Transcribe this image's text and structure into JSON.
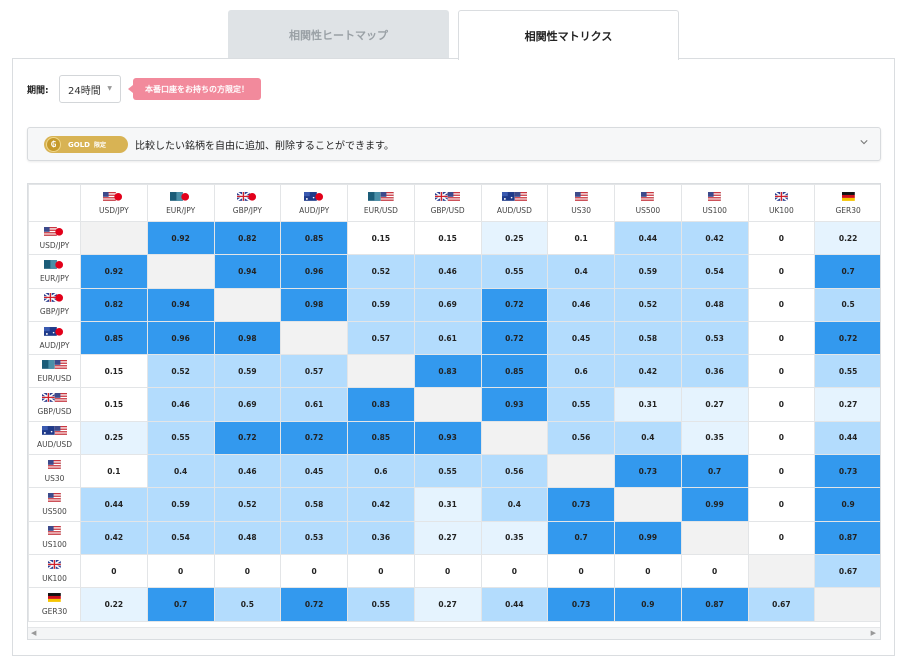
{
  "tabs": [
    {
      "label": "相関性ヒートマップ",
      "active": false
    },
    {
      "label": "相関性マトリクス",
      "active": true
    }
  ],
  "period": {
    "label": "期間:",
    "value": "24時間"
  },
  "promo": "本番口座をお持ちの方限定！",
  "gold": {
    "badge": "GOLD",
    "limit": "限定",
    "message": "比較したい銘柄を自由に追加、削除することができます。"
  },
  "colors": {
    "strong": "#3399ee",
    "medium": "#b3dcfd",
    "weak": "#e5f3fe",
    "none": "#ffffff",
    "diagonal": "#f2f2f2"
  },
  "symbols": [
    "USD/JPY",
    "EUR/JPY",
    "GBP/JPY",
    "AUD/JPY",
    "EUR/USD",
    "GBP/USD",
    "AUD/USD",
    "US30",
    "US500",
    "US100",
    "UK100",
    "GER30"
  ],
  "symbol_flags": [
    [
      "us",
      "jp"
    ],
    [
      "eu",
      "jp"
    ],
    [
      "gb",
      "jp"
    ],
    [
      "au",
      "jp"
    ],
    [
      "eu",
      "us"
    ],
    [
      "gb",
      "us"
    ],
    [
      "au",
      "us"
    ],
    [
      "us"
    ],
    [
      "us"
    ],
    [
      "us"
    ],
    [
      "gb"
    ],
    [
      "de"
    ]
  ],
  "matrix": [
    [
      null,
      "0.92",
      "0.82",
      "0.85",
      "0.15",
      "0.15",
      "0.25",
      "0.1",
      "0.44",
      "0.42",
      "0",
      "0.22"
    ],
    [
      "0.92",
      null,
      "0.94",
      "0.96",
      "0.52",
      "0.46",
      "0.55",
      "0.4",
      "0.59",
      "0.54",
      "0",
      "0.7"
    ],
    [
      "0.82",
      "0.94",
      null,
      "0.98",
      "0.59",
      "0.69",
      "0.72",
      "0.46",
      "0.52",
      "0.48",
      "0",
      "0.5"
    ],
    [
      "0.85",
      "0.96",
      "0.98",
      null,
      "0.57",
      "0.61",
      "0.72",
      "0.45",
      "0.58",
      "0.53",
      "0",
      "0.72"
    ],
    [
      "0.15",
      "0.52",
      "0.59",
      "0.57",
      null,
      "0.83",
      "0.85",
      "0.6",
      "0.42",
      "0.36",
      "0",
      "0.55"
    ],
    [
      "0.15",
      "0.46",
      "0.69",
      "0.61",
      "0.83",
      null,
      "0.93",
      "0.55",
      "0.31",
      "0.27",
      "0",
      "0.27"
    ],
    [
      "0.25",
      "0.55",
      "0.72",
      "0.72",
      "0.85",
      "0.93",
      null,
      "0.56",
      "0.4",
      "0.35",
      "0",
      "0.44"
    ],
    [
      "0.1",
      "0.4",
      "0.46",
      "0.45",
      "0.6",
      "0.55",
      "0.56",
      null,
      "0.73",
      "0.7",
      "0",
      "0.73"
    ],
    [
      "0.44",
      "0.59",
      "0.52",
      "0.58",
      "0.42",
      "0.31",
      "0.4",
      "0.73",
      null,
      "0.99",
      "0",
      "0.9"
    ],
    [
      "0.42",
      "0.54",
      "0.48",
      "0.53",
      "0.36",
      "0.27",
      "0.35",
      "0.7",
      "0.99",
      null,
      "0",
      "0.87"
    ],
    [
      "0",
      "0",
      "0",
      "0",
      "0",
      "0",
      "0",
      "0",
      "0",
      "0",
      null,
      "0.67"
    ],
    [
      "0.22",
      "0.7",
      "0.5",
      "0.72",
      "0.55",
      "0.27",
      "0.44",
      "0.73",
      "0.9",
      "0.87",
      "0.67",
      null
    ]
  ]
}
